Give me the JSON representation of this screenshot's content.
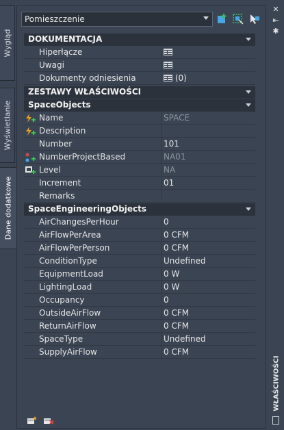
{
  "left_tabs": [
    {
      "label": "Wygląd"
    },
    {
      "label": "Wyświetlanie"
    },
    {
      "label": "Dane dodatkowe"
    }
  ],
  "selector": {
    "value": "Pomieszczenie"
  },
  "sections": {
    "doc": {
      "title": "DOKUMENTACJA",
      "rows": [
        {
          "key": "Hiperłącze"
        },
        {
          "key": "Uwagi"
        },
        {
          "key": "Dokumenty odniesienia",
          "value": "(0)"
        }
      ]
    },
    "psets": {
      "title": "ZESTAWY WŁAŚCIWOŚCI"
    },
    "space_objects": {
      "title": "SpaceObjects",
      "rows": [
        {
          "key": "Name",
          "value": "SPACE"
        },
        {
          "key": "Description",
          "value": ""
        },
        {
          "key": "Number",
          "value": "101"
        },
        {
          "key": "NumberProjectBased",
          "value": "NA01"
        },
        {
          "key": "Level",
          "value": "NA"
        },
        {
          "key": "Increment",
          "value": "01"
        },
        {
          "key": "Remarks",
          "value": ""
        }
      ]
    },
    "space_eng": {
      "title": "SpaceEngineeringObjects",
      "rows": [
        {
          "key": "AirChangesPerHour",
          "value": "0"
        },
        {
          "key": "AirFlowPerArea",
          "value": "0 CFM"
        },
        {
          "key": "AirFlowPerPerson",
          "value": "0 CFM"
        },
        {
          "key": "ConditionType",
          "value": "Undefined"
        },
        {
          "key": "EquipmentLoad",
          "value": "0 W"
        },
        {
          "key": "LightingLoad",
          "value": "0 W"
        },
        {
          "key": "Occupancy",
          "value": "0"
        },
        {
          "key": "OutsideAirFlow",
          "value": "0 CFM"
        },
        {
          "key": "ReturnAirFlow",
          "value": "0 CFM"
        },
        {
          "key": "SpaceType",
          "value": "Undefined"
        },
        {
          "key": "SupplyAirFlow",
          "value": "0 CFM"
        }
      ]
    }
  },
  "palette_title": "WŁAŚCIWOŚCI",
  "right_buttons": {
    "close": "✕",
    "pin": "⇤",
    "settings": "✱"
  },
  "colors": {
    "background": "#3b4453",
    "header": "#2c323c",
    "accent_green": "#3fbf5a",
    "accent_orange": "#f0a020",
    "accent_blue": "#46a7e8"
  }
}
